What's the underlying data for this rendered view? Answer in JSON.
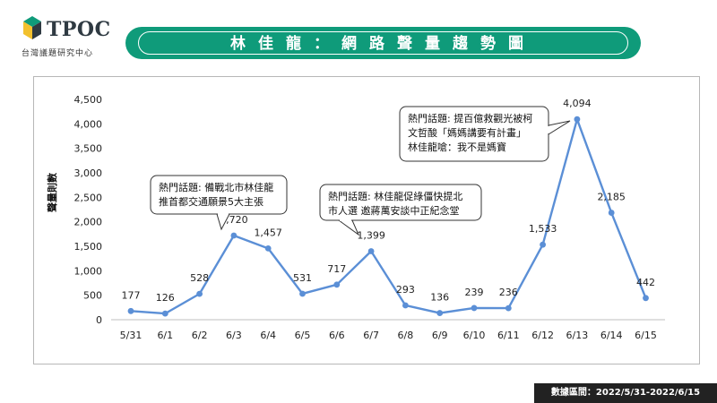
{
  "logo": {
    "name": "TPOC",
    "subtitle": "台灣議題研究中心"
  },
  "title": "林佳龍：網路聲量趨勢圖",
  "footer": "數據區間：2022/5/31-2022/6/15",
  "colors": {
    "accent": "#0f9b7a",
    "line": "#5b8fd6"
  },
  "chart_data": {
    "type": "line",
    "title": "",
    "xlabel": "",
    "ylabel": "聲量則數",
    "ylim": [
      0,
      4500
    ],
    "yticks": [
      "0",
      "500",
      "1,000",
      "1,500",
      "2,000",
      "2,500",
      "3,000",
      "3,500",
      "4,000",
      "4,500"
    ],
    "ytick_values": [
      0,
      500,
      1000,
      1500,
      2000,
      2500,
      3000,
      3500,
      4000,
      4500
    ],
    "categories": [
      "5/31",
      "6/1",
      "6/2",
      "6/3",
      "6/4",
      "6/5",
      "6/6",
      "6/7",
      "6/8",
      "6/9",
      "6/10",
      "6/11",
      "6/12",
      "6/13",
      "6/14",
      "6/15"
    ],
    "values": [
      177,
      126,
      528,
      1720,
      1457,
      531,
      717,
      1399,
      293,
      136,
      239,
      236,
      1533,
      4094,
      2185,
      442
    ],
    "labels": [
      "177",
      "126",
      "528",
      "1,720",
      "1,457",
      "531",
      "717",
      "1,399",
      "293",
      "136",
      "239",
      "236",
      "1,533",
      "4,094",
      "2,185",
      "442"
    ],
    "grid": false,
    "annotations": [
      {
        "index": 3,
        "lines": [
          "熱門話題: 備戰北市林佳龍",
          "推首都交通願景5大主張"
        ]
      },
      {
        "index": 7,
        "lines": [
          "熱門話題: 林佳龍促綠僵快提北",
          "市人選 邀蔣萬安談中正紀念堂"
        ]
      },
      {
        "index": 13,
        "lines": [
          "熱門話題: 提百億救觀光被柯",
          "文哲酸「媽媽講要有計畫」",
          "林佳龍嗆：我不是媽寶"
        ]
      }
    ]
  }
}
